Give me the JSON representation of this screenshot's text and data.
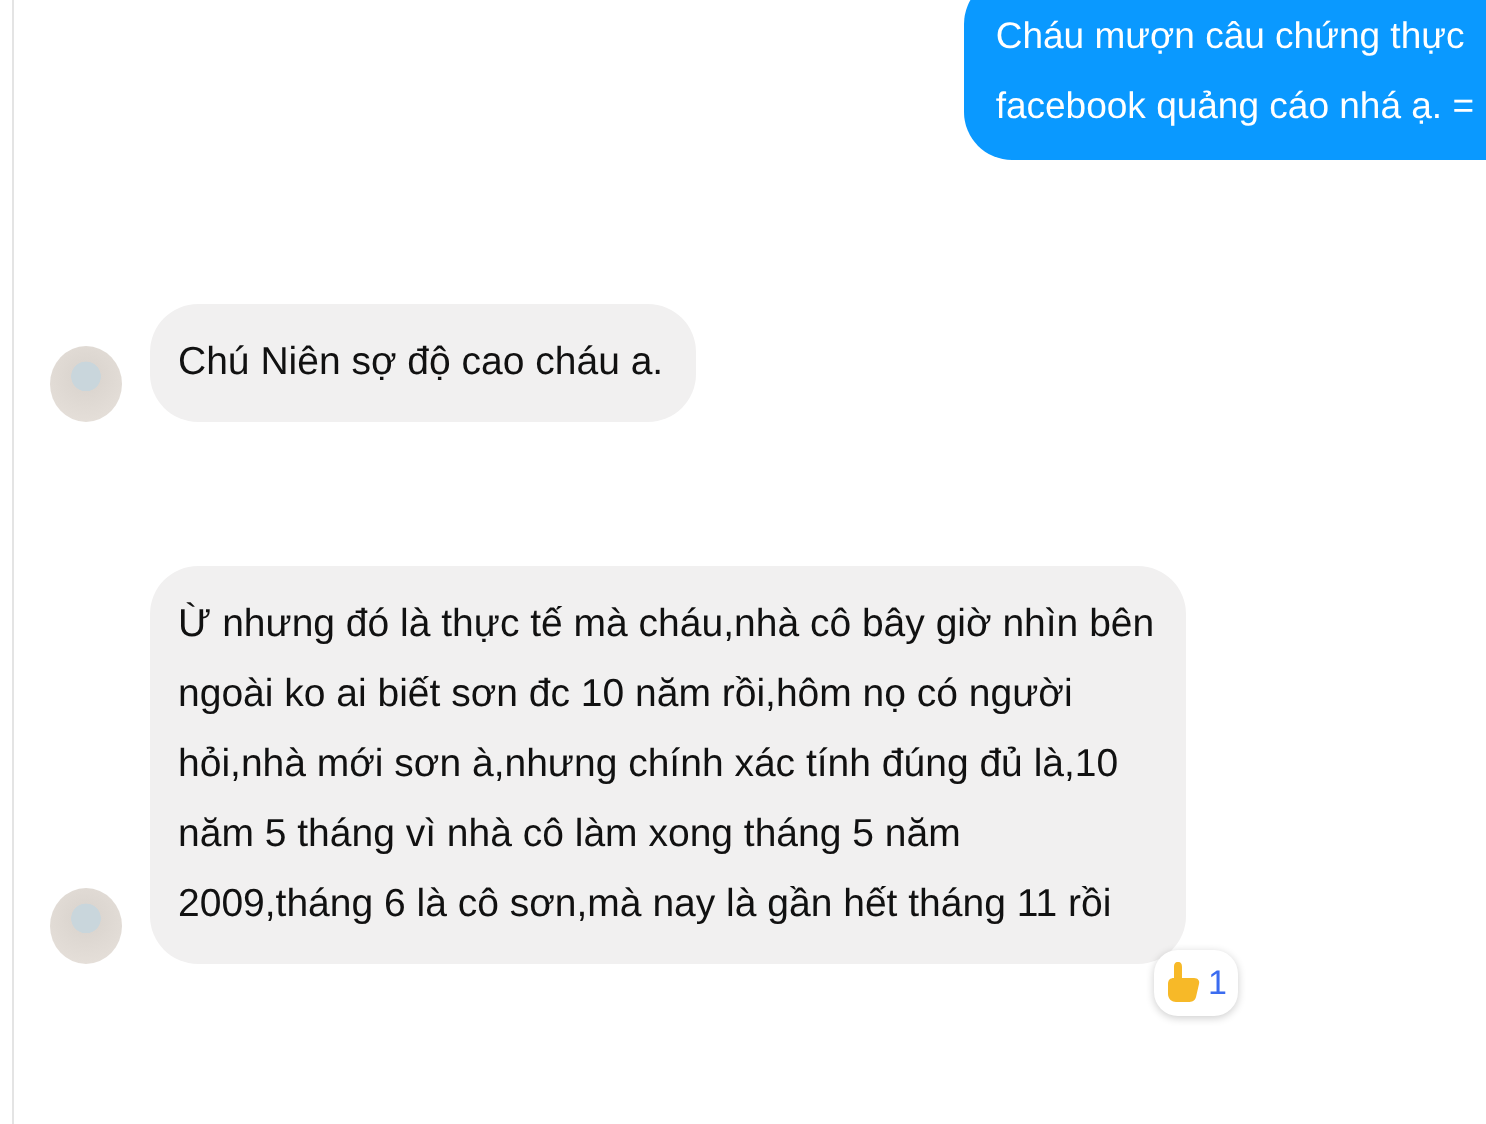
{
  "messages": [
    {
      "kind": "outgoing",
      "lines": [
        "Cháu mượn câu chứng thực",
        "facebook quảng cáo nhá ạ. ="
      ]
    },
    {
      "kind": "incoming",
      "lines": [
        "Chú Niên sợ độ cao cháu a."
      ]
    },
    {
      "kind": "incoming",
      "lines": [
        "Ừ nhưng đó là thực tế mà cháu,nhà cô bây giờ nhìn bên",
        "ngoài ko ai biết sơn đc 10 năm rồi,hôm nọ có người",
        "hỏi,nhà mới sơn à,nhưng chính xác tính đúng đủ là,10",
        "năm 5 tháng vì nhà cô làm xong tháng 5 năm",
        "2009,tháng 6 là cô sơn,mà nay là gần hết tháng 11 rồi"
      ],
      "reaction": {
        "count": "1"
      }
    }
  ]
}
